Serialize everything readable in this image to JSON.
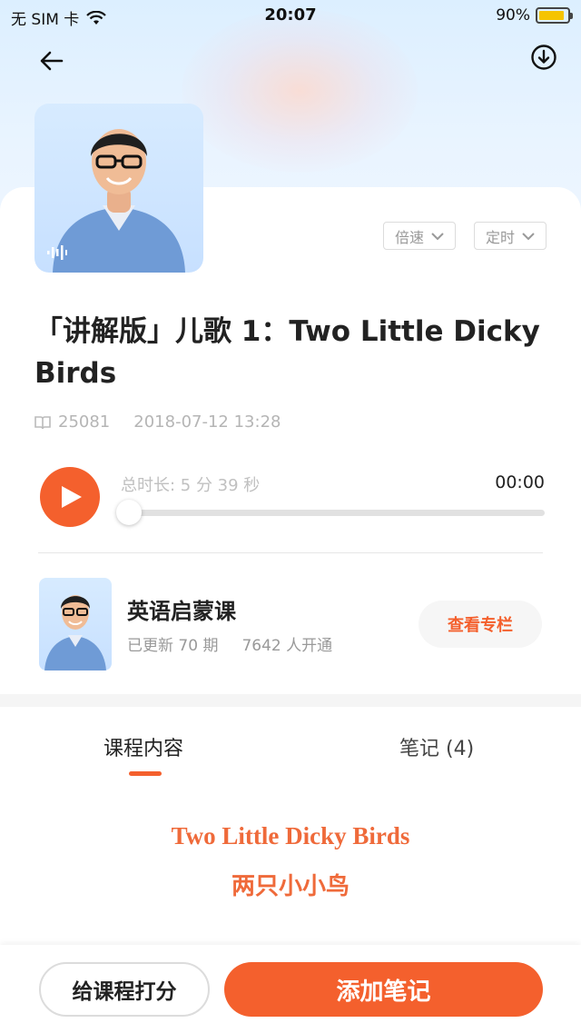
{
  "status_bar": {
    "carrier": "无 SIM 卡",
    "time": "20:07",
    "battery_text": "90%",
    "battery_level": 0.9,
    "battery_color": "#f5c400"
  },
  "nav": {
    "back_icon": "arrow-left-icon",
    "download_icon": "download-circle-icon"
  },
  "player": {
    "speed_label": "倍速",
    "timer_label": "定时",
    "title": "「讲解版」儿歌 1：Two Little Dicky Birds",
    "play_count": "25081",
    "publish_date": "2018-07-12 13:28",
    "duration_text": "总时长: 5 分 39 秒",
    "current_time": "00:00",
    "progress": 0.0
  },
  "column": {
    "title": "英语启蒙课",
    "updates": "已更新 70 期",
    "subscribers": "7642 人开通",
    "view_button": "查看专栏"
  },
  "tabs": [
    {
      "label": "课程内容",
      "active": true
    },
    {
      "label": "笔记 (4)",
      "active": false
    }
  ],
  "content": {
    "lyric_en": "Two Little Dicky Birds",
    "lyric_zh": "两只小小鸟"
  },
  "bottom": {
    "rate_button": "给课程打分",
    "note_button": "添加笔记"
  },
  "colors": {
    "accent": "#f4602d",
    "lyric": "#ef6a3a"
  }
}
